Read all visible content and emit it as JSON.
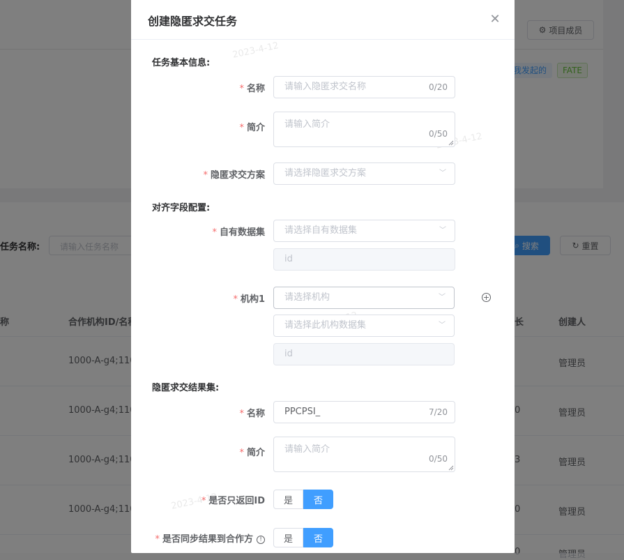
{
  "background": {
    "members_button": "项目成员",
    "tags": [
      "我发起的",
      "FATE"
    ],
    "search": {
      "label": "任务名称:",
      "placeholder": "请输入任务名称",
      "search_button": "搜索",
      "reset_button": "重置"
    },
    "table": {
      "headers": [
        "称",
        "合作机构ID/名称",
        "长",
        "创建人"
      ],
      "rows": [
        {
          "partner": "1000-A-g4;110",
          "dur": "",
          "creator": "管理员"
        },
        {
          "partner": "1000-A-g4;110",
          "dur": "0",
          "creator": "管理员"
        },
        {
          "partner": "1000-A-g4;110",
          "dur": "3",
          "creator": "管理员"
        },
        {
          "partner": "1000-A-g4;110",
          "dur": "0",
          "creator": "管理员"
        },
        {
          "partner": "",
          "dur": "0",
          "creator": "管理员"
        }
      ]
    },
    "watermark": "2023-4-12"
  },
  "dialog": {
    "title": "创建隐匿求交任务",
    "sections": {
      "basic": "任务基本信息:",
      "align": "对齐字段配置:",
      "result": "隐匿求交结果集:"
    },
    "basic": {
      "name_label": "名称",
      "name_placeholder": "请输入隐匿求交名称",
      "name_count": "0/20",
      "desc_label": "简介",
      "desc_placeholder": "请输入简介",
      "desc_count": "0/50",
      "scheme_label": "隐匿求交方案",
      "scheme_placeholder": "请选择隐匿求交方案"
    },
    "align": {
      "own_label": "自有数据集",
      "own_placeholder": "请选择自有数据集",
      "own_field": "id",
      "org_label": "机构1",
      "org_placeholder": "请选择机构",
      "org_dataset_placeholder": "请选择此机构数据集",
      "org_field": "id"
    },
    "result": {
      "name_label": "名称",
      "name_value": "PPCPSI_",
      "name_count": "7/20",
      "desc_label": "简介",
      "desc_placeholder": "请输入简介",
      "desc_count": "0/50",
      "only_id_label": "是否只返回ID",
      "sync_label": "是否同步结果到合作方",
      "yes": "是",
      "no": "否"
    }
  }
}
